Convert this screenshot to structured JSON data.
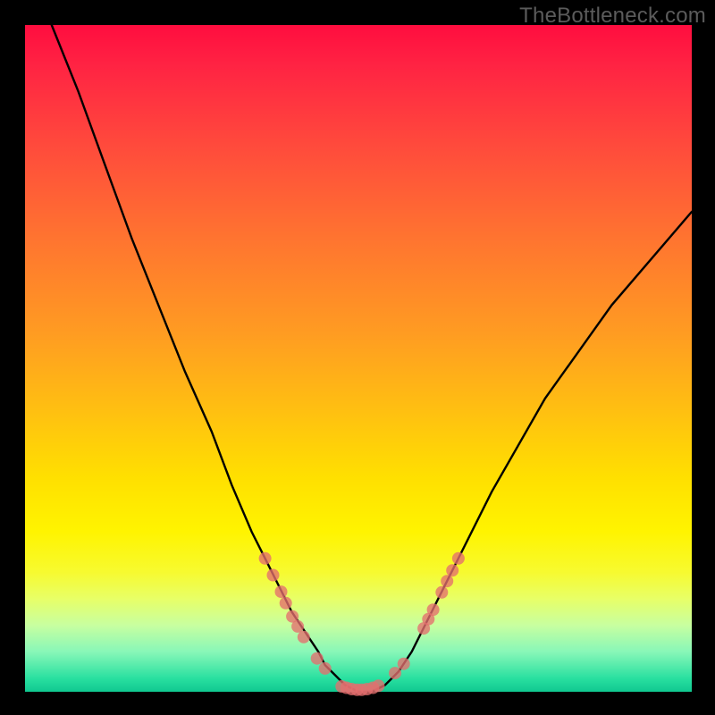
{
  "watermark": "TheBottleneck.com",
  "chart_data": {
    "type": "line",
    "title": "",
    "xlabel": "",
    "ylabel": "",
    "xlim": [
      0,
      100
    ],
    "ylim": [
      0,
      100
    ],
    "series": [
      {
        "name": "bottleneck-curve",
        "x": [
          4,
          8,
          12,
          16,
          20,
          24,
          28,
          31,
          34,
          36,
          38,
          40,
          42,
          44,
          45,
          46,
          48,
          50,
          52,
          54,
          56,
          58,
          60,
          64,
          70,
          78,
          88,
          100
        ],
        "values": [
          100,
          90,
          79,
          68,
          58,
          48,
          39,
          31,
          24,
          20,
          16,
          12,
          9,
          6,
          4,
          3,
          1,
          0,
          0,
          1,
          3,
          6,
          10,
          18,
          30,
          44,
          58,
          72
        ]
      }
    ],
    "markers": {
      "name": "sample-dots",
      "color": "#e46e6e",
      "points": [
        {
          "x": 36.0,
          "y": 20.0
        },
        {
          "x": 37.2,
          "y": 17.5
        },
        {
          "x": 38.4,
          "y": 15.0
        },
        {
          "x": 39.1,
          "y": 13.3
        },
        {
          "x": 40.1,
          "y": 11.3
        },
        {
          "x": 40.9,
          "y": 9.8
        },
        {
          "x": 41.8,
          "y": 8.2
        },
        {
          "x": 43.8,
          "y": 5.0
        },
        {
          "x": 45.0,
          "y": 3.5
        },
        {
          "x": 47.5,
          "y": 0.8
        },
        {
          "x": 48.2,
          "y": 0.6
        },
        {
          "x": 49.0,
          "y": 0.4
        },
        {
          "x": 49.8,
          "y": 0.3
        },
        {
          "x": 50.5,
          "y": 0.3
        },
        {
          "x": 51.3,
          "y": 0.4
        },
        {
          "x": 52.2,
          "y": 0.6
        },
        {
          "x": 53.0,
          "y": 0.9
        },
        {
          "x": 55.5,
          "y": 2.8
        },
        {
          "x": 56.8,
          "y": 4.2
        },
        {
          "x": 59.8,
          "y": 9.5
        },
        {
          "x": 60.5,
          "y": 10.9
        },
        {
          "x": 61.2,
          "y": 12.3
        },
        {
          "x": 62.5,
          "y": 14.9
        },
        {
          "x": 63.3,
          "y": 16.6
        },
        {
          "x": 64.1,
          "y": 18.2
        },
        {
          "x": 65.0,
          "y": 20.0
        }
      ]
    }
  }
}
